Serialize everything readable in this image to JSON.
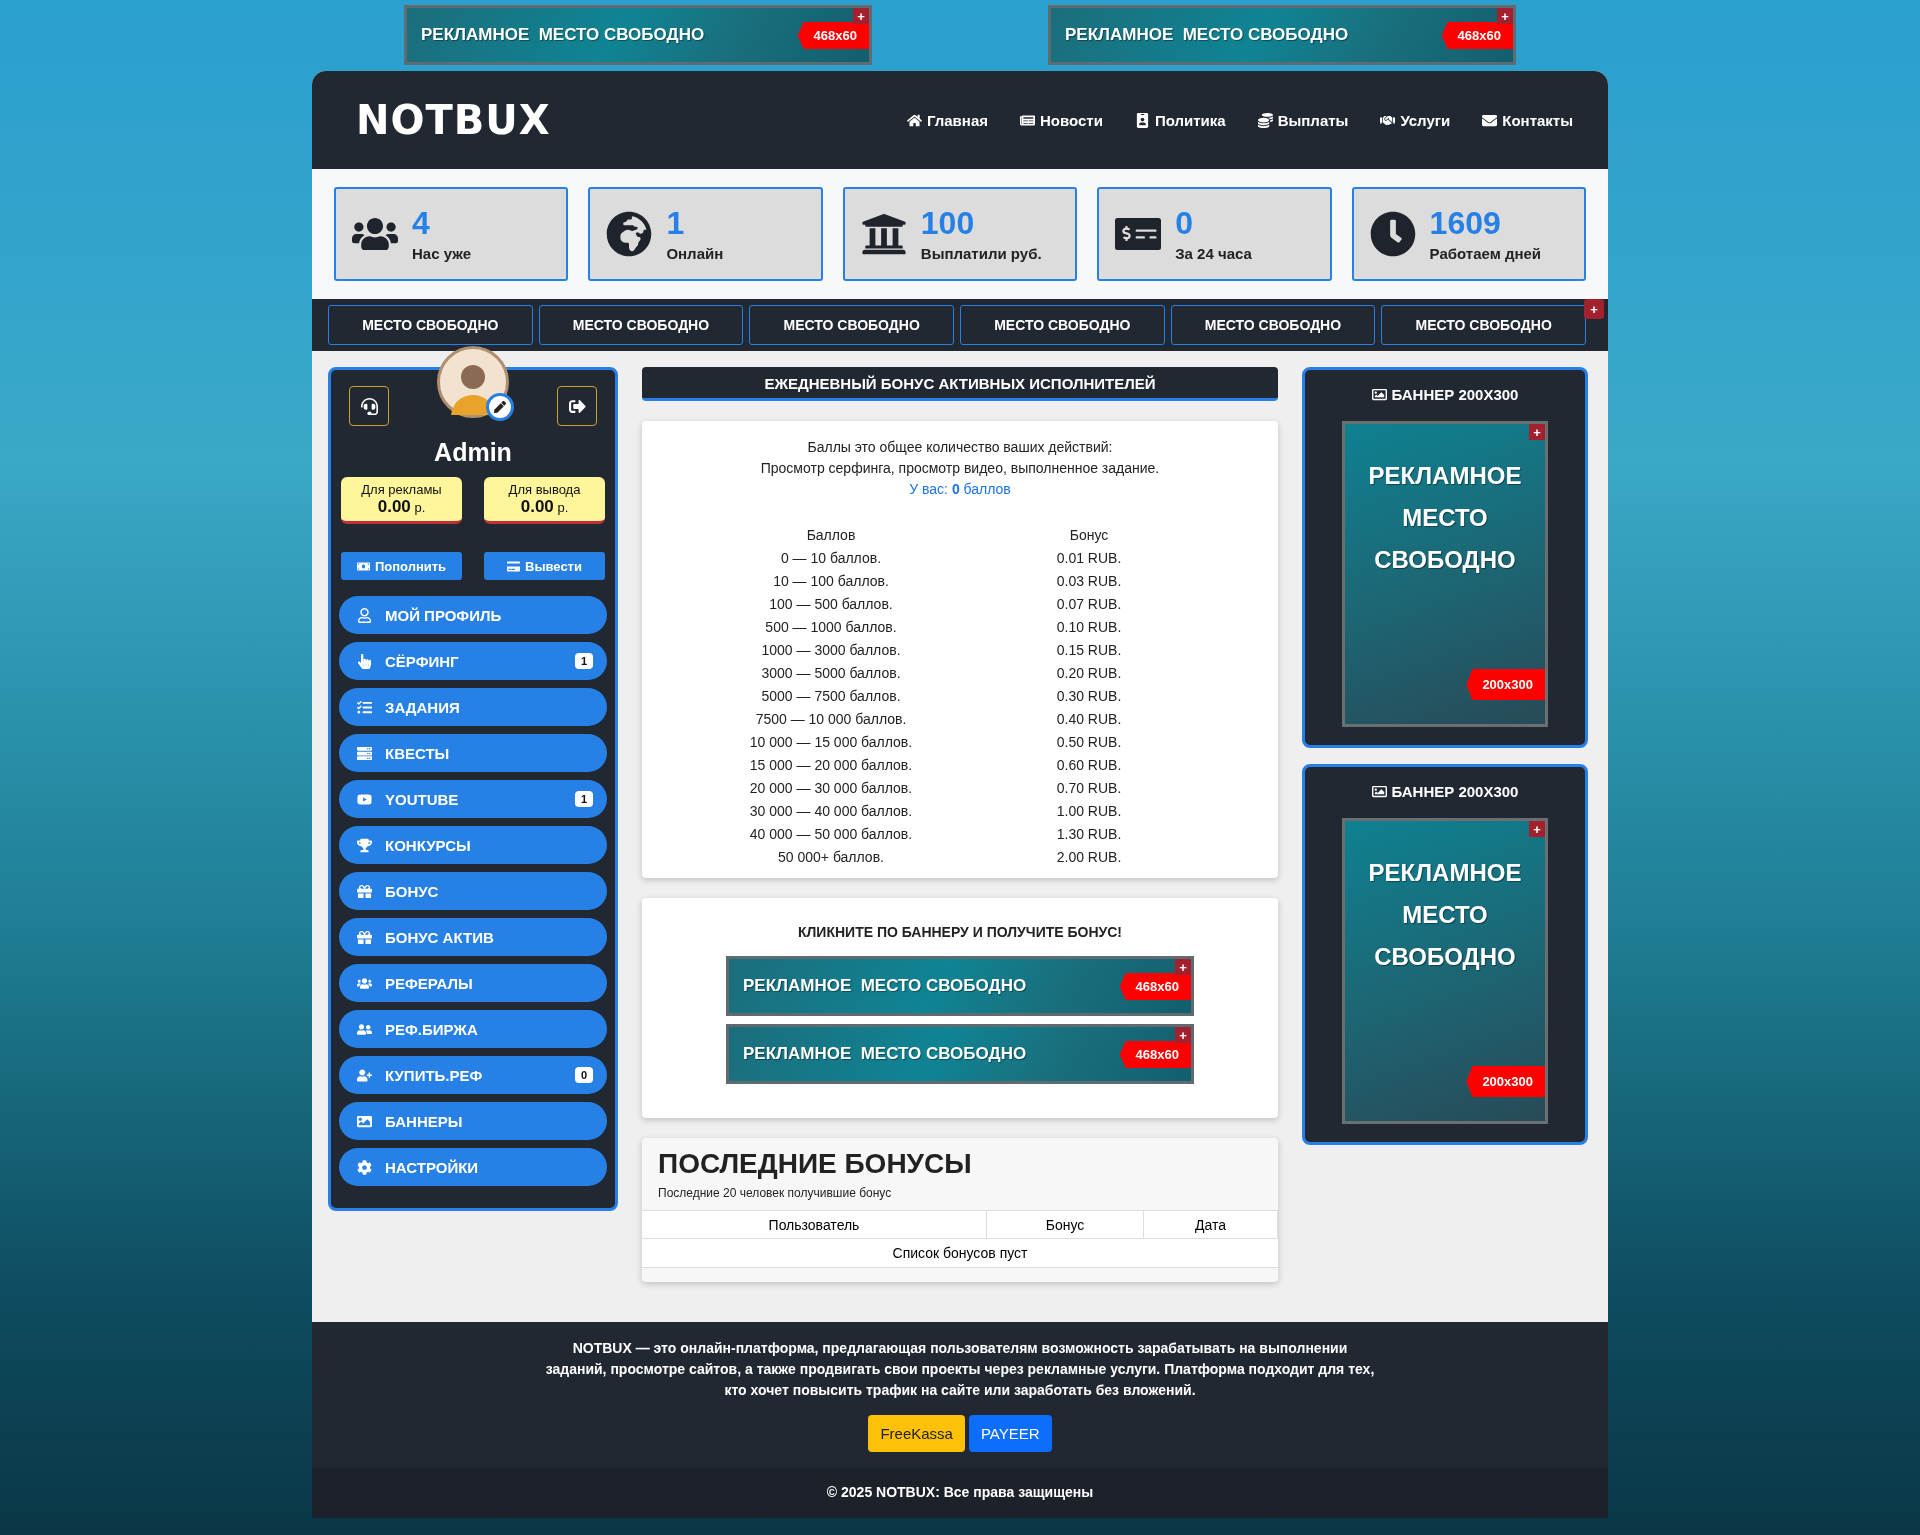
{
  "top_banners": [
    {
      "text": "РЕКЛАМНОЕ  МЕСТО СВОБОДНО",
      "size": "468x60",
      "corner": "+"
    },
    {
      "text": "РЕКЛАМНОЕ  МЕСТО СВОБОДНО",
      "size": "468x60",
      "corner": "+"
    }
  ],
  "header": {
    "logo": "NOTBUX",
    "nav": [
      "Главная",
      "Новости",
      "Политика",
      "Выплаты",
      "Услуги",
      "Контакты"
    ]
  },
  "stats": [
    {
      "value": "4",
      "label": "Нас уже"
    },
    {
      "value": "1",
      "label": "Онлайн"
    },
    {
      "value": "100",
      "label": "Выплатили руб."
    },
    {
      "value": "0",
      "label": "За 24 часа"
    },
    {
      "value": "1609",
      "label": "Работаем дней"
    }
  ],
  "ad_strip": {
    "items": [
      "МЕСТО СВОБОДНО",
      "МЕСТО СВОБОДНО",
      "МЕСТО СВОБОДНО",
      "МЕСТО СВОБОДНО",
      "МЕСТО СВОБОДНО",
      "МЕСТО СВОБОДНО"
    ],
    "corner": "+"
  },
  "sidebar": {
    "username": "Admin",
    "balances": [
      {
        "label": "Для рекламы",
        "amount": "0.00",
        "unit": "р."
      },
      {
        "label": "Для вывода",
        "amount": "0.00",
        "unit": "р."
      }
    ],
    "actions": [
      "Пополнить",
      "Вывести"
    ],
    "menu": [
      {
        "label": "МОЙ ПРОФИЛЬ"
      },
      {
        "label": "СЁРФИНГ",
        "badge": "1"
      },
      {
        "label": "ЗАДАНИЯ"
      },
      {
        "label": "КВЕСТЫ"
      },
      {
        "label": "YOUTUBE",
        "badge": "1"
      },
      {
        "label": "КОНКУРСЫ"
      },
      {
        "label": "БОНУС"
      },
      {
        "label": "БОНУС АКТИВ"
      },
      {
        "label": "РЕФЕРАЛЫ"
      },
      {
        "label": "РЕФ.БИРЖА"
      },
      {
        "label": "КУПИТЬ.РЕФ",
        "badge": "0"
      },
      {
        "label": "БАННЕРЫ"
      },
      {
        "label": "НАСТРОЙКИ"
      }
    ]
  },
  "bonus": {
    "title": "ЕЖЕДНЕВНЫЙ БОНУС АКТИВНЫХ ИСПОЛНИТЕЛЕЙ",
    "intro": [
      "Баллы это общее количество ваших действий:",
      "Просмотр серфинга, просмотр видео, выполненное задание."
    ],
    "your_points": "У вас: **0** баллов",
    "columns": [
      "Баллов",
      "Бонус"
    ],
    "rows": [
      [
        "0 — 10 баллов.",
        "0.01 RUB."
      ],
      [
        "10 — 100 баллов.",
        "0.03 RUB."
      ],
      [
        "100 — 500 баллов.",
        "0.07 RUB."
      ],
      [
        "500 — 1000 баллов.",
        "0.10 RUB."
      ],
      [
        "1000 — 3000 баллов.",
        "0.15 RUB."
      ],
      [
        "3000 — 5000 баллов.",
        "0.20 RUB."
      ],
      [
        "5000 — 7500 баллов.",
        "0.30 RUB."
      ],
      [
        "7500 — 10 000 баллов.",
        "0.40 RUB."
      ],
      [
        "10 000 — 15 000 баллов.",
        "0.50 RUB."
      ],
      [
        "15 000 — 20 000 баллов.",
        "0.60 RUB."
      ],
      [
        "20 000 — 30 000 баллов.",
        "0.70 RUB."
      ],
      [
        "30 000 — 40 000 баллов.",
        "1.00 RUB."
      ],
      [
        "40 000 — 50 000 баллов.",
        "1.30 RUB."
      ],
      [
        "50 000+ баллов.",
        "2.00 RUB."
      ]
    ]
  },
  "click_bonus": {
    "title": "КЛИКНИТЕ ПО БАННЕРУ И ПОЛУЧИТЕ БОНУС!",
    "banners": [
      {
        "text": "РЕКЛАМНОЕ  МЕСТО СВОБОДНО",
        "size": "468x60",
        "corner": "+"
      },
      {
        "text": "РЕКЛАМНОЕ  МЕСТО СВОБОДНО",
        "size": "468x60",
        "corner": "+"
      }
    ]
  },
  "recent": {
    "title": "ПОСЛЕДНИЕ БОНУСЫ",
    "subtitle": "Последние 20 человек получившие бонус",
    "columns": [
      "Пользователь",
      "Бонус",
      "Дата"
    ],
    "empty": "Список бонусов пуст"
  },
  "right_banners": [
    {
      "title": "БАННЕР 200X300",
      "lines": [
        "РЕКЛАМНОЕ",
        "МЕСТО",
        "СВОБОДНО"
      ],
      "size": "200x300",
      "corner": "+"
    },
    {
      "title": "БАННЕР 200X300",
      "lines": [
        "РЕКЛАМНОЕ",
        "МЕСТО",
        "СВОБОДНО"
      ],
      "size": "200x300",
      "corner": "+"
    }
  ],
  "footer": {
    "text": "NOTBUX — это онлайн-платформа, предлагающая пользователям возможность зарабатывать на выполнении заданий, просмотре сайтов, а также продвигать свои проекты через рекламные услуги. Платформа подходит для тех, кто хочет повысить трафик на сайте или заработать без вложений.",
    "payments": [
      "FreeKassa",
      "PAYEER"
    ],
    "copyright": "© 2025 NOTBUX: Все права защищены"
  }
}
